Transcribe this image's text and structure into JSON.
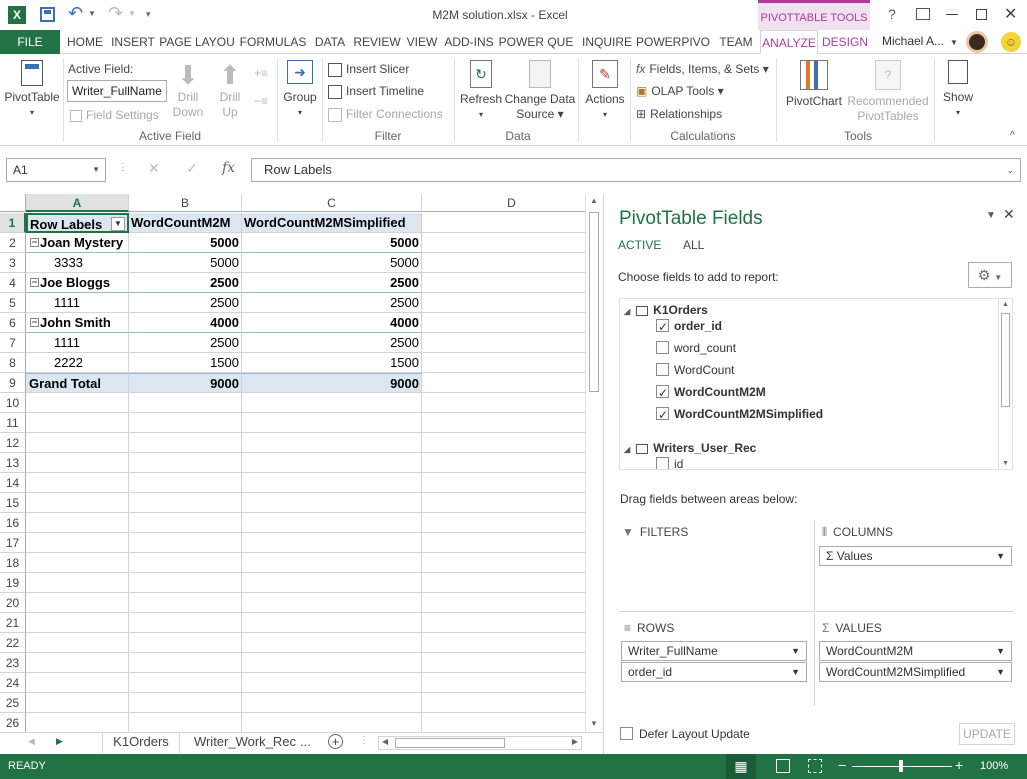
{
  "titlebar": {
    "title": "M2M solution.xlsx - Excel",
    "contextual": "PIVOTTABLE TOOLS",
    "help": "?"
  },
  "tabs": [
    "FILE",
    "HOME",
    "INSERT",
    "PAGE LAYOU",
    "FORMULAS",
    "DATA",
    "REVIEW",
    "VIEW",
    "ADD-INS",
    "POWER QUE",
    "INQUIRE",
    "POWERPIVO",
    "TEAM",
    "ANALYZE",
    "DESIGN"
  ],
  "user": "Michael A...",
  "ribbon": {
    "pivottable": "PivotTable",
    "active_field_label": "Active Field:",
    "active_field_value": "Writer_FullName",
    "field_settings": "Field Settings",
    "drill_down": [
      "Drill",
      "Down"
    ],
    "drill_up": [
      "Drill",
      "Up"
    ],
    "group": "Group",
    "active_field_group": "Active Field",
    "insert_slicer": "Insert Slicer",
    "insert_timeline": "Insert Timeline",
    "filter_connections": "Filter Connections",
    "filter_group": "Filter",
    "refresh": "Refresh",
    "change_data_source": [
      "Change Data",
      "Source"
    ],
    "data_group": "Data",
    "actions": "Actions",
    "fields_items_sets": "Fields, Items, & Sets",
    "olap_tools": "OLAP Tools",
    "relationships": "Relationships",
    "calculations_group": "Calculations",
    "pivotchart": "PivotChart",
    "recommended": [
      "Recommended",
      "PivotTables"
    ],
    "tools_group": "Tools",
    "show": "Show"
  },
  "formula_bar": {
    "name_box": "A1",
    "fx": "fx",
    "content": "Row Labels"
  },
  "sheet": {
    "columns": [
      "A",
      "B",
      "C",
      "D"
    ],
    "row_numbers": [
      "1",
      "2",
      "3",
      "4",
      "5",
      "6",
      "7",
      "8",
      "9",
      "10",
      "11",
      "12",
      "13",
      "14",
      "15",
      "16",
      "17",
      "18",
      "19",
      "20",
      "21",
      "22",
      "23",
      "24",
      "25",
      "26"
    ],
    "header": [
      "Row Labels",
      "WordCountM2M",
      "WordCountM2MSimplified"
    ],
    "rows": [
      {
        "label": "Joan Mystery",
        "b": "5000",
        "c": "5000",
        "kind": "group"
      },
      {
        "label": "3333",
        "b": "5000",
        "c": "5000",
        "kind": "item"
      },
      {
        "label": "Joe Bloggs",
        "b": "2500",
        "c": "2500",
        "kind": "group"
      },
      {
        "label": "1111",
        "b": "2500",
        "c": "2500",
        "kind": "item"
      },
      {
        "label": "John Smith",
        "b": "4000",
        "c": "4000",
        "kind": "group"
      },
      {
        "label": "1111",
        "b": "2500",
        "c": "2500",
        "kind": "item"
      },
      {
        "label": "2222",
        "b": "1500",
        "c": "1500",
        "kind": "item"
      },
      {
        "label": "Grand Total",
        "b": "9000",
        "c": "9000",
        "kind": "total"
      }
    ],
    "tabs": [
      "K1Orders",
      "Writer_Work_Rec",
      "..."
    ]
  },
  "pane": {
    "title": "PivotTable Fields",
    "tab_active": "ACTIVE",
    "tab_all": "ALL",
    "choose": "Choose fields to add to report:",
    "tables": [
      {
        "name": "K1Orders",
        "fields": [
          {
            "name": "order_id",
            "checked": true
          },
          {
            "name": "word_count",
            "checked": false
          },
          {
            "name": "WordCount",
            "checked": false
          },
          {
            "name": "WordCountM2M",
            "checked": true
          },
          {
            "name": "WordCountM2MSimplified",
            "checked": true
          }
        ]
      },
      {
        "name": "Writers_User_Rec",
        "fields": [
          {
            "name": "id",
            "checked": false
          }
        ]
      }
    ],
    "drag": "Drag fields between areas below:",
    "filters": "FILTERS",
    "columns": "COLUMNS",
    "rows": "ROWS",
    "values": "VALUES",
    "columns_items": [
      "Σ  Values"
    ],
    "rows_items": [
      "Writer_FullName",
      "order_id"
    ],
    "values_items": [
      "WordCountM2M",
      "WordCountM2MSimplified"
    ],
    "defer": "Defer Layout Update",
    "update": "UPDATE"
  },
  "status": {
    "ready": "READY",
    "zoom": "100%"
  },
  "colors": {
    "excel_green": "#217346",
    "selected_header": "#e1e1e1",
    "pivot_header": "#dce6f1"
  }
}
